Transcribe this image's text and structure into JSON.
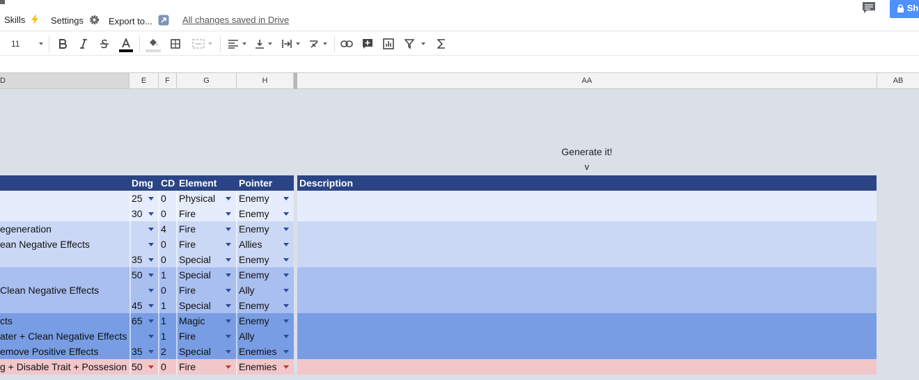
{
  "menu": {
    "skills": "Skills",
    "settings": "Settings",
    "export": "Export to...",
    "saved_status": "All changes saved in Drive",
    "share_label": "Sh",
    "icons": {
      "skills": "lightning-icon",
      "settings": "gear-icon",
      "export": "external-link-icon",
      "comments": "comment-icon",
      "share": "lock-icon"
    }
  },
  "toolbar": {
    "font_size": "11",
    "buttons": [
      "bold",
      "italic",
      "strikethrough",
      "text-color",
      "fill-color",
      "borders",
      "merge-cells",
      "horizontal-align",
      "vertical-align",
      "text-wrap",
      "text-rotation",
      "insert-link",
      "insert-comment",
      "insert-chart",
      "filter",
      "functions"
    ]
  },
  "columns": [
    "D",
    "E",
    "F",
    "G",
    "H",
    "AA",
    "AB"
  ],
  "grid": {
    "generate_label": "Generate it!",
    "generate_arrow": "v",
    "headers": {
      "dmg": "Dmg",
      "cd": "CD",
      "element": "Element",
      "pointer": "Pointer",
      "description": "Description"
    },
    "rows": [
      {
        "name": "",
        "dmg": "25",
        "cd": "0",
        "element": "Physical",
        "pointer": "Enemy",
        "color": "#e5ecfb"
      },
      {
        "name": "",
        "dmg": "30",
        "cd": "0",
        "element": "Fire",
        "pointer": "Enemy",
        "color": "#e5ecfb"
      },
      {
        "name": "egeneration",
        "dmg": "",
        "cd": "4",
        "element": "Fire",
        "pointer": "Enemy",
        "color": "#cbd8f5"
      },
      {
        "name": "ean Negative Effects",
        "dmg": "",
        "cd": "0",
        "element": "Fire",
        "pointer": "Allies",
        "color": "#cbd8f5"
      },
      {
        "name": "",
        "dmg": "35",
        "cd": "0",
        "element": "Special",
        "pointer": "Enemy",
        "color": "#cbd8f5"
      },
      {
        "name": "",
        "dmg": "50",
        "cd": "1",
        "element": "Special",
        "pointer": "Enemy",
        "color": "#a9bff0"
      },
      {
        "name": "Clean Negative Effects",
        "dmg": "",
        "cd": "0",
        "element": "Fire",
        "pointer": "Ally",
        "color": "#a9bff0"
      },
      {
        "name": "",
        "dmg": "45",
        "cd": "1",
        "element": "Special",
        "pointer": "Enemy",
        "color": "#a9bff0"
      },
      {
        "name": "cts",
        "dmg": "65",
        "cd": "1",
        "element": "Magic",
        "pointer": "Enemy",
        "color": "#789de4"
      },
      {
        "name": "ater + Clean Negative Effects",
        "dmg": "",
        "cd": "1",
        "element": "Fire",
        "pointer": "Ally",
        "color": "#789de4"
      },
      {
        "name": "emove Positive Effects",
        "dmg": "35",
        "cd": "2",
        "element": "Special",
        "pointer": "Enemies",
        "color": "#789de4"
      },
      {
        "name": "g + Disable Trait + Possesion",
        "dmg": "50",
        "cd": "0",
        "element": "Fire",
        "pointer": "Enemies",
        "color": "#f1c7ca"
      }
    ]
  },
  "colors": {
    "header_bg": "#2b4485",
    "grid_bg": "#dbdfe8",
    "share_bg": "#4d90fe"
  }
}
